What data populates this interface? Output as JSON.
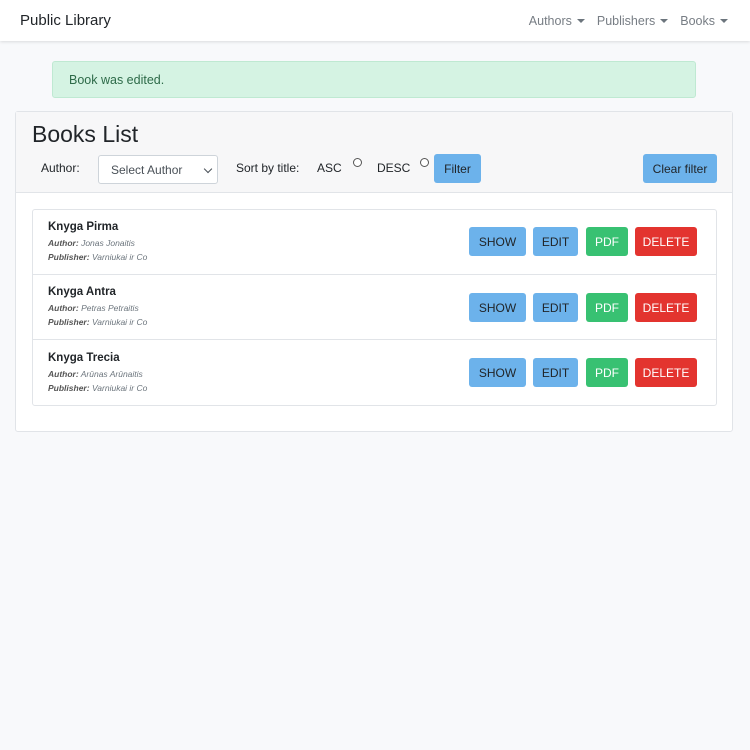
{
  "navbar": {
    "brand": "Public Library",
    "menus": [
      {
        "label": "Authors"
      },
      {
        "label": "Publishers"
      },
      {
        "label": "Books"
      }
    ]
  },
  "alert": {
    "message": "Book was edited.",
    "color": "#d5f3e3"
  },
  "card": {
    "title": "Books List",
    "filters": {
      "author_label": "Author:",
      "author_select_value": "Select Author",
      "sort_label": "Sort by title:",
      "asc_label": "ASC",
      "desc_label": "DESC",
      "filter_button": "Filter",
      "clear_button": "Clear filter"
    }
  },
  "books": [
    {
      "title": "Knyga Pirma",
      "author_label": "Author:",
      "author": "Jonas Jonaitis",
      "publisher_label": "Publisher:",
      "publisher": "Varniukai ir Co"
    },
    {
      "title": "Knyga Antra",
      "author_label": "Author:",
      "author": "Petras Petraitis",
      "publisher_label": "Publisher:",
      "publisher": "Varniukai ir Co"
    },
    {
      "title": "Knyga Trecia",
      "author_label": "Author:",
      "author": "Arūnas Arūnaitis",
      "publisher_label": "Publisher:",
      "publisher": "Varniukai ir Co"
    }
  ],
  "actions": {
    "show": "SHOW",
    "edit": "EDIT",
    "pdf": "PDF",
    "delete": "DELETE"
  },
  "colors": {
    "info": "#6cb2eb",
    "success": "#38c172",
    "danger": "#e3342f"
  }
}
